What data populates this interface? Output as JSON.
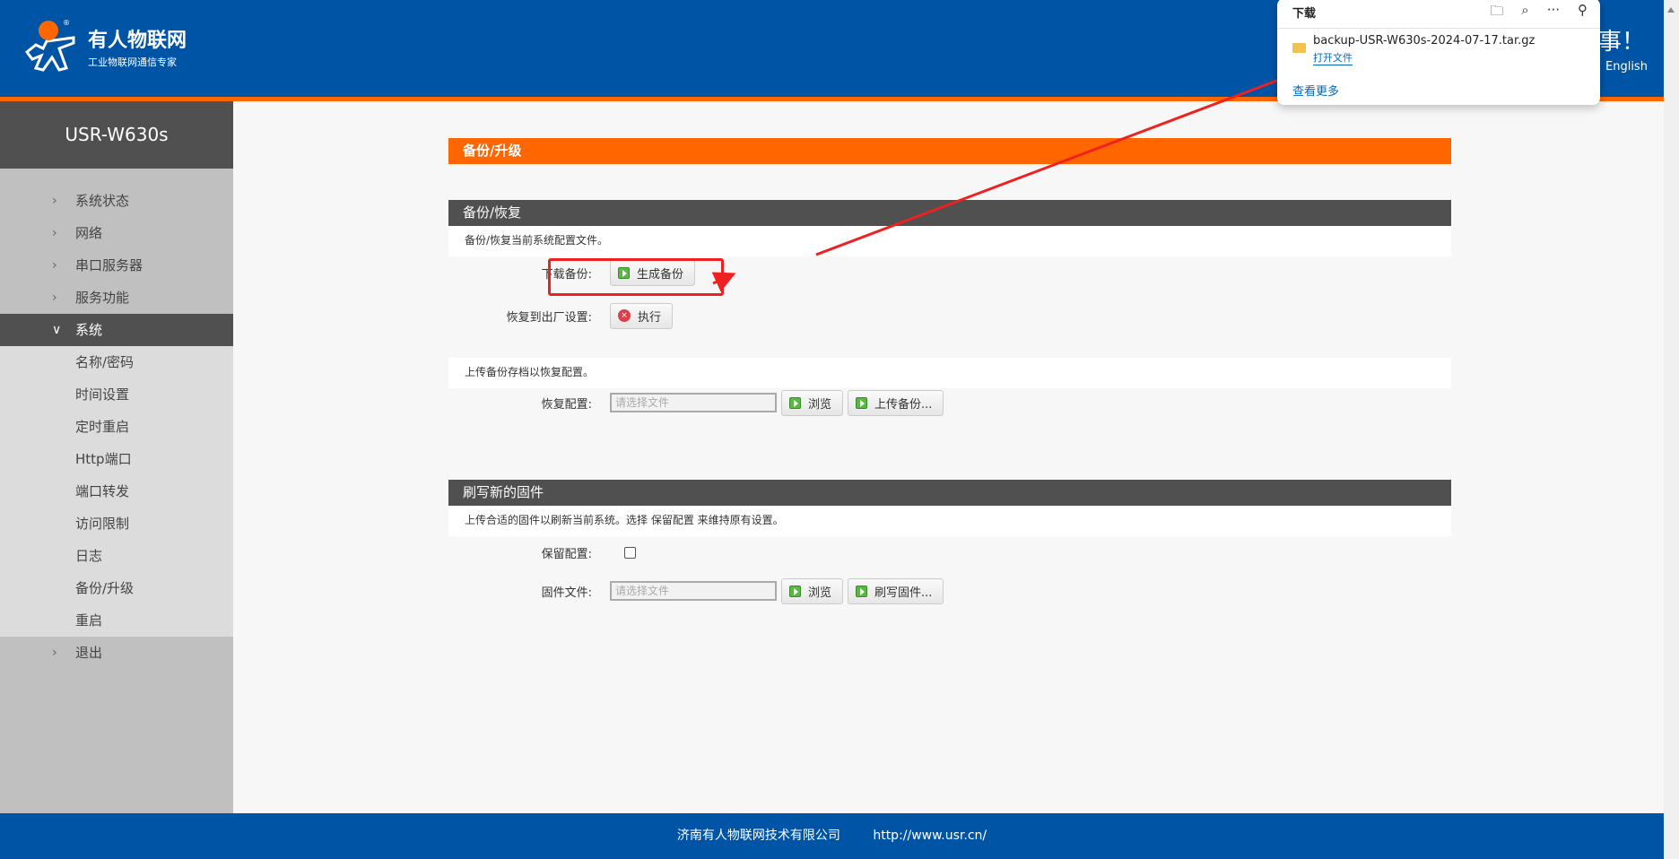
{
  "header": {
    "brand": "有人物联网",
    "subtitle": "工业物联网通信专家",
    "slogan": "事！",
    "language": "English"
  },
  "sidebar": {
    "title": "USR-W630s",
    "items": [
      {
        "label": "系统状态",
        "type": "collapsed"
      },
      {
        "label": "网络",
        "type": "collapsed"
      },
      {
        "label": "串口服务器",
        "type": "collapsed"
      },
      {
        "label": "服务功能",
        "type": "collapsed"
      },
      {
        "label": "系统",
        "type": "expanded"
      },
      {
        "label": "名称/密码",
        "type": "sub"
      },
      {
        "label": "时间设置",
        "type": "sub"
      },
      {
        "label": "定时重启",
        "type": "sub"
      },
      {
        "label": "Http端口",
        "type": "sub"
      },
      {
        "label": "端口转发",
        "type": "sub"
      },
      {
        "label": "访问限制",
        "type": "sub"
      },
      {
        "label": "日志",
        "type": "sub"
      },
      {
        "label": "备份/升级",
        "type": "sub"
      },
      {
        "label": "重启",
        "type": "sub"
      },
      {
        "label": "退出",
        "type": "collapsed"
      }
    ]
  },
  "main": {
    "title": "备份/升级",
    "backup": {
      "heading": "备份/恢复",
      "desc": "备份/恢复当前系统配置文件。",
      "download_label": "下载备份:",
      "generate_btn": "生成备份",
      "factory_label": "恢复到出厂设置:",
      "execute_btn": "执行",
      "upload_desc": "上传备份存档以恢复配置。",
      "restore_label": "恢复配置:",
      "file_placeholder": "请选择文件",
      "browse_btn": "浏览",
      "upload_btn": "上传备份..."
    },
    "firmware": {
      "heading": "刷写新的固件",
      "desc": "上传合适的固件以刷新当前系统。选择 保留配置 来维持原有设置。",
      "keep_label": "保留配置:",
      "file_label": "固件文件:",
      "file_placeholder": "请选择文件",
      "browse_btn": "浏览",
      "flash_btn": "刷写固件..."
    }
  },
  "footer": {
    "company": "济南有人物联网技术有限公司",
    "url": "http://www.usr.cn/"
  },
  "downloads": {
    "title": "下载",
    "filename": "backup-USR-W630s-2024-07-17.tar.gz",
    "open_file": "打开文件",
    "see_more": "查看更多"
  },
  "colors": {
    "brand_blue": "#0054a6",
    "accent_orange": "#ff6600",
    "annotation_red": "#f02020"
  }
}
